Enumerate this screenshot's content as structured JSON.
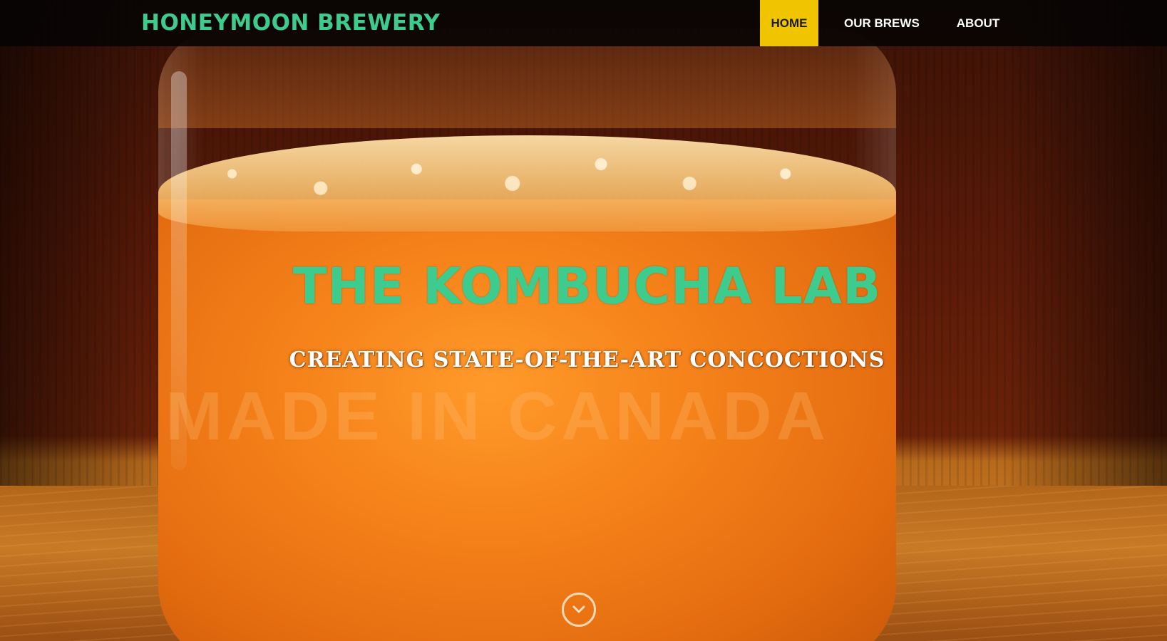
{
  "brand": {
    "name": "HONEYMOON BREWERY",
    "color": "#3ecb8e"
  },
  "nav": {
    "items": [
      {
        "label": "HOME",
        "active": true
      },
      {
        "label": "OUR BREWS",
        "active": false
      },
      {
        "label": "ABOUT",
        "active": false
      }
    ],
    "active_color": "#f0c500"
  },
  "hero": {
    "title": "THE KOMBUCHA LAB",
    "subtitle": "CREATING STATE-OF-THE-ART CONCOCTIONS",
    "background_image": "photo of a glass mason jar filled with orange kombucha and foam on a wooden table",
    "jar_embossing": "MADE IN CANADA",
    "scroll_icon": "chevron-down-icon"
  }
}
